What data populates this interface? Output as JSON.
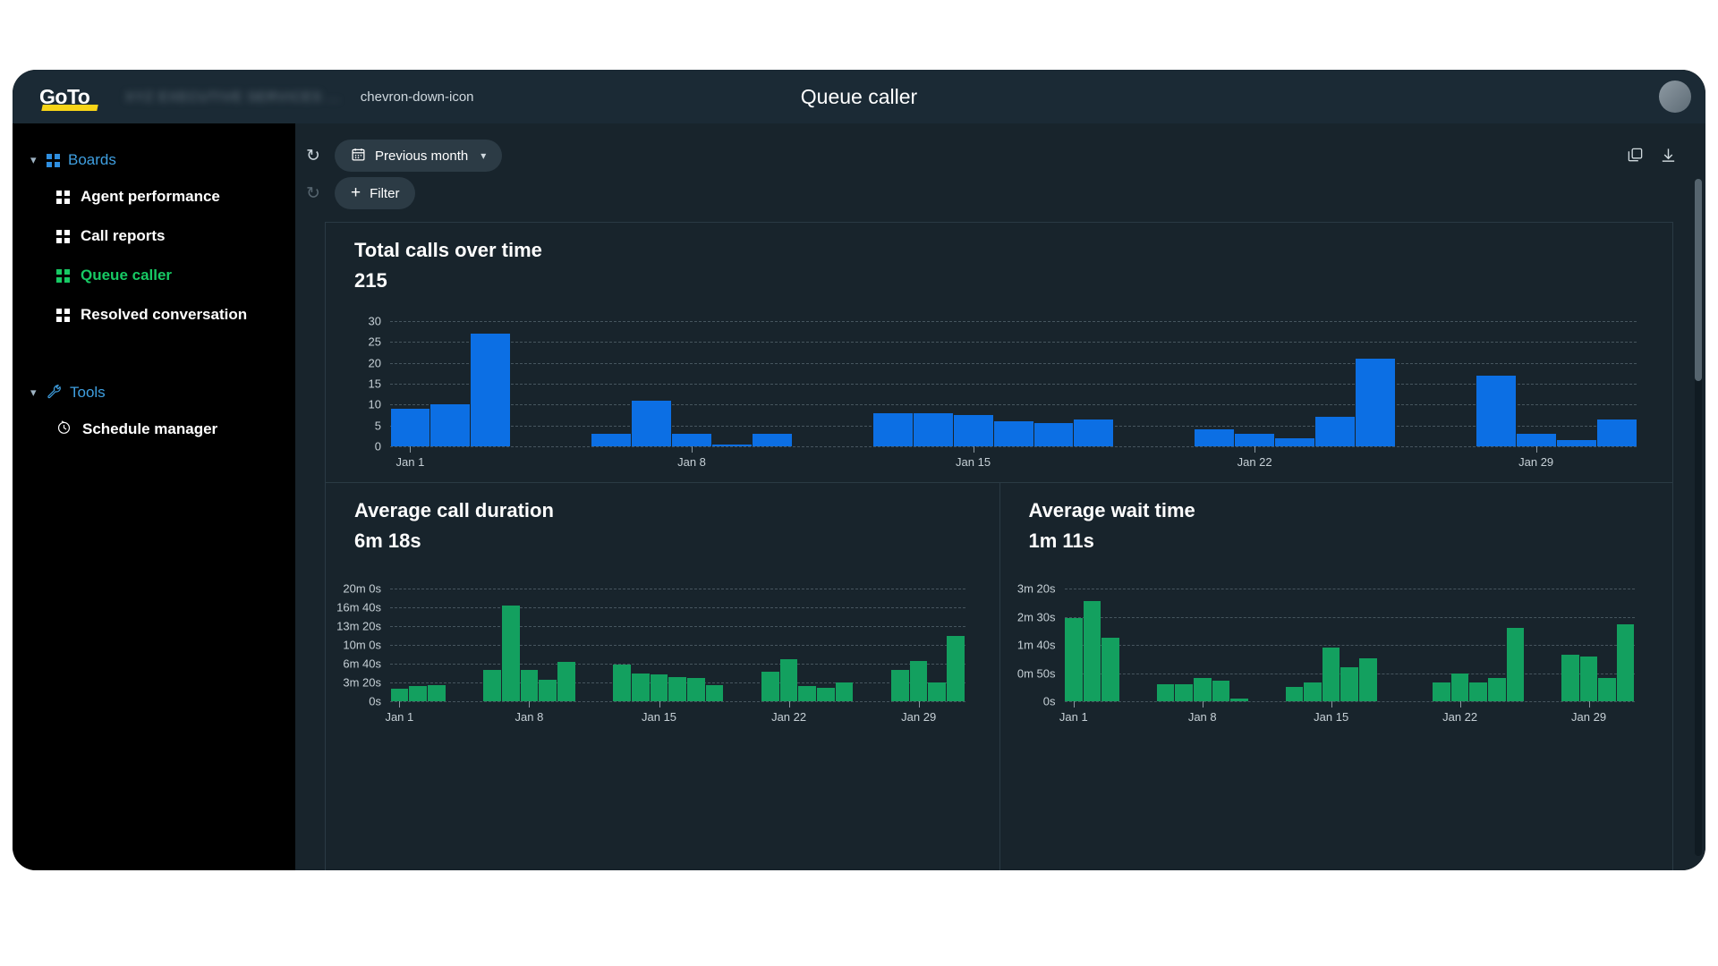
{
  "app": {
    "logo_text": "GoTo",
    "account_name": "XYZ EXECUTIVE SERVICES ...",
    "title": "Queue caller",
    "account_chevron_icon": "chevron-down-icon",
    "avatar_icon": "avatar"
  },
  "sidebar": {
    "groups": [
      {
        "label": "Boards",
        "icon": "grid-icon",
        "chevron": "⌄",
        "items": [
          {
            "label": "Agent performance",
            "icon": "grid-icon",
            "active": false
          },
          {
            "label": "Call reports",
            "icon": "grid-icon",
            "active": false
          },
          {
            "label": "Queue caller",
            "icon": "grid-icon",
            "active": true
          },
          {
            "label": "Resolved conversation",
            "icon": "grid-icon",
            "active": false
          }
        ]
      },
      {
        "label": "Tools",
        "icon": "wrench-icon",
        "chevron": "⌄",
        "items": [
          {
            "label": "Schedule manager",
            "icon": "clock-icon",
            "active": false
          }
        ]
      }
    ]
  },
  "toolbar": {
    "reset_date_icon": "reset-icon",
    "reset_filter_icon": "reset-icon",
    "date_range_label": "Previous month",
    "date_range_icon": "calendar-icon",
    "date_range_chevron": "⌄",
    "filter_label": "Filter",
    "filter_plus": "+",
    "copy_icon": "copy-icon",
    "download_icon": "download-icon"
  },
  "colors": {
    "accent_blue": "#0c6fe4",
    "accent_green": "#13a05f",
    "active_nav": "#17c964",
    "brand_yellow": "#f7d417",
    "panel_bg": "#18242c",
    "topbar_bg": "#1b2a35"
  },
  "chart_data": [
    {
      "type": "bar",
      "id": "total-calls-over-time",
      "title": "Total calls over time",
      "value": "215",
      "xlabel": "",
      "ylabel": "",
      "ylim": [
        0,
        30
      ],
      "yticks": [
        30,
        25,
        20,
        15,
        10,
        5,
        0
      ],
      "ytick_labels": [
        "30",
        "25",
        "20",
        "15",
        "10",
        "5",
        "0"
      ],
      "grid": true,
      "legend": "none",
      "color": "#0c6fe4",
      "xtick_labels": [
        "Jan 1",
        "Jan 8",
        "Jan 15",
        "Jan 22",
        "Jan 29"
      ],
      "xtick_indices": [
        0,
        7,
        14,
        21,
        28
      ],
      "categories": [
        "Jan 1",
        "Jan 2",
        "Jan 3",
        "Jan 4",
        "Jan 5",
        "Jan 6",
        "Jan 7",
        "Jan 8",
        "Jan 9",
        "Jan 10",
        "Jan 11",
        "Jan 12",
        "Jan 13",
        "Jan 14",
        "Jan 15",
        "Jan 16",
        "Jan 17",
        "Jan 18",
        "Jan 19",
        "Jan 20",
        "Jan 21",
        "Jan 22",
        "Jan 23",
        "Jan 24",
        "Jan 25",
        "Jan 26",
        "Jan 27",
        "Jan 28",
        "Jan 29",
        "Jan 30",
        "Jan 31"
      ],
      "values": [
        9,
        10,
        27,
        0,
        0,
        3,
        11,
        3,
        0.5,
        3,
        0,
        0,
        8,
        8,
        7.5,
        6,
        5.5,
        6.5,
        0,
        0,
        4,
        3,
        2,
        7,
        21,
        0,
        0,
        17,
        3,
        1.5,
        6.5
      ]
    },
    {
      "type": "bar",
      "id": "average-call-duration",
      "title": "Average call duration",
      "value": "6m 18s",
      "xlabel": "",
      "ylabel": "",
      "ylim": [
        0,
        1200
      ],
      "yticks": [
        1200,
        1000,
        800,
        600,
        400,
        200,
        0
      ],
      "ytick_labels": [
        "20m 0s",
        "16m 40s",
        "13m 20s",
        "10m 0s",
        "6m 40s",
        "3m 20s",
        "0s"
      ],
      "grid": true,
      "legend": "none",
      "color": "#13a05f",
      "xtick_labels": [
        "Jan 1",
        "Jan 8",
        "Jan 15",
        "Jan 22",
        "Jan 29"
      ],
      "xtick_indices": [
        0,
        7,
        14,
        21,
        28
      ],
      "categories": [
        "Jan 1",
        "Jan 2",
        "Jan 3",
        "Jan 4",
        "Jan 5",
        "Jan 6",
        "Jan 7",
        "Jan 8",
        "Jan 9",
        "Jan 10",
        "Jan 11",
        "Jan 12",
        "Jan 13",
        "Jan 14",
        "Jan 15",
        "Jan 16",
        "Jan 17",
        "Jan 18",
        "Jan 19",
        "Jan 20",
        "Jan 21",
        "Jan 22",
        "Jan 23",
        "Jan 24",
        "Jan 25",
        "Jan 26",
        "Jan 27",
        "Jan 28",
        "Jan 29",
        "Jan 30",
        "Jan 31"
      ],
      "values": [
        130,
        160,
        170,
        0,
        0,
        330,
        1020,
        330,
        230,
        420,
        0,
        0,
        390,
        300,
        290,
        260,
        250,
        170,
        0,
        0,
        310,
        450,
        160,
        140,
        200,
        0,
        0,
        330,
        430,
        200,
        700
      ]
    },
    {
      "type": "bar",
      "id": "average-wait-time",
      "title": "Average wait time",
      "value": "1m 11s",
      "xlabel": "",
      "ylabel": "",
      "ylim": [
        0,
        200
      ],
      "yticks": [
        200,
        150,
        100,
        50,
        0
      ],
      "ytick_labels": [
        "3m 20s",
        "2m 30s",
        "1m 40s",
        "0m 50s",
        "0s"
      ],
      "grid": true,
      "legend": "none",
      "color": "#13a05f",
      "xtick_labels": [
        "Jan 1",
        "Jan 8",
        "Jan 15",
        "Jan 22",
        "Jan 29"
      ],
      "xtick_indices": [
        0,
        7,
        14,
        21,
        28
      ],
      "categories": [
        "Jan 1",
        "Jan 2",
        "Jan 3",
        "Jan 4",
        "Jan 5",
        "Jan 6",
        "Jan 7",
        "Jan 8",
        "Jan 9",
        "Jan 10",
        "Jan 11",
        "Jan 12",
        "Jan 13",
        "Jan 14",
        "Jan 15",
        "Jan 16",
        "Jan 17",
        "Jan 18",
        "Jan 19",
        "Jan 20",
        "Jan 21",
        "Jan 22",
        "Jan 23",
        "Jan 24",
        "Jan 25",
        "Jan 26",
        "Jan 27",
        "Jan 28",
        "Jan 29",
        "Jan 30",
        "Jan 31"
      ],
      "values": [
        148,
        178,
        112,
        0,
        0,
        30,
        30,
        42,
        36,
        4,
        0,
        0,
        26,
        34,
        96,
        60,
        76,
        0,
        0,
        0,
        34,
        50,
        34,
        42,
        130,
        0,
        0,
        82,
        80,
        42,
        136
      ]
    }
  ]
}
